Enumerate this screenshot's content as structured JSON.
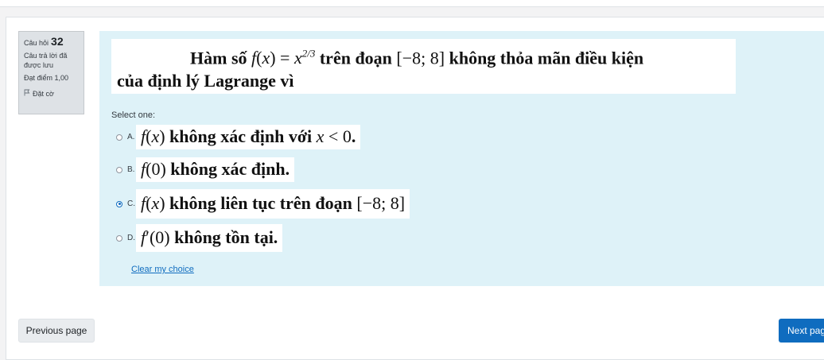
{
  "question_info": {
    "label": "Câu hỏi",
    "number": "32",
    "state": "Câu trả lời đã được lưu",
    "mark": "Đạt điểm 1,00",
    "flag_label": "Đặt cờ"
  },
  "question": {
    "text_before": "Hàm số",
    "text_middle": "trên đoạn",
    "text_after": "không thỏa mãn điều kiện",
    "text_line2": "của định lý Lagrange vì"
  },
  "prompt": "Select one:",
  "options": [
    {
      "letter": "A.",
      "text": "không xác định với",
      "selected": false
    },
    {
      "letter": "B.",
      "text": "không xác định.",
      "selected": false
    },
    {
      "letter": "C.",
      "text": "không liên tục trên đoạn",
      "selected": true
    },
    {
      "letter": "D.",
      "text": "không tồn tại.",
      "selected": false
    }
  ],
  "clear_choice": "Clear my choice",
  "nav": {
    "previous": "Previous page",
    "next": "Next page"
  },
  "colors": {
    "accent": "#0f6cbf",
    "formulation_bg": "#def2f8",
    "info_bg": "#dee2e6"
  }
}
